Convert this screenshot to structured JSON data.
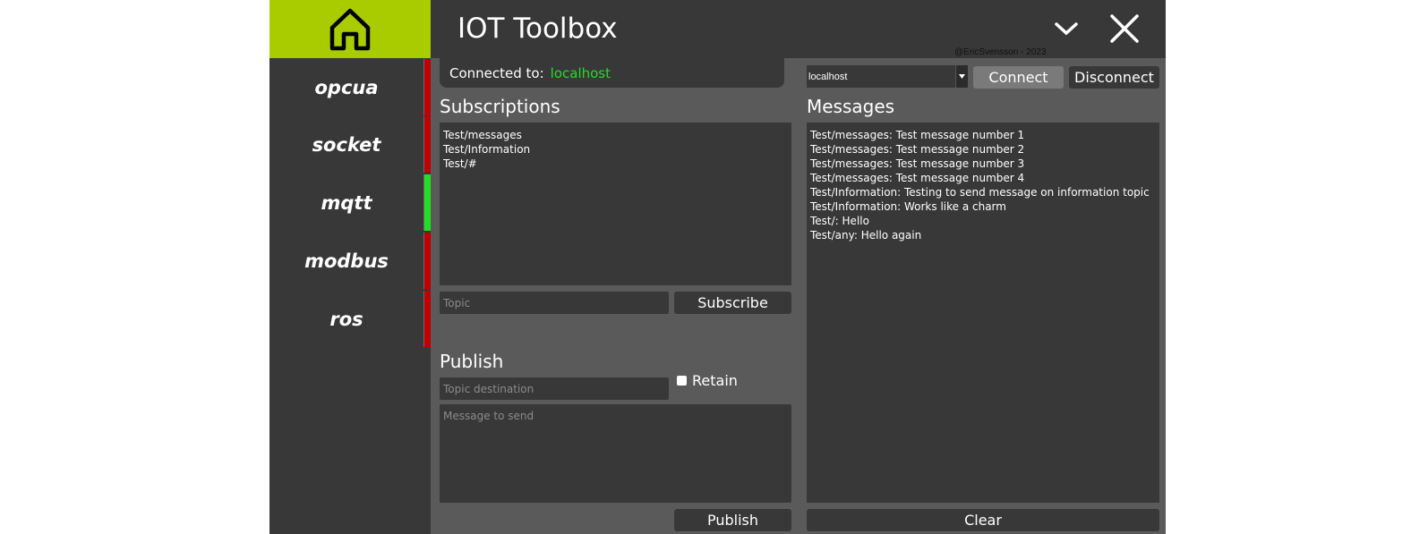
{
  "app": {
    "title": "IOT Toolbox",
    "copyright": "@EricSvensson - 2023"
  },
  "sidebar": {
    "items": [
      {
        "label": "opcua",
        "status_color": "#c00000"
      },
      {
        "label": "socket",
        "status_color": "#c00000"
      },
      {
        "label": "mqtt",
        "status_color": "#22dd22"
      },
      {
        "label": "modbus",
        "status_color": "#c00000"
      },
      {
        "label": "ros",
        "status_color": "#c00000"
      }
    ]
  },
  "connection": {
    "label": "Connected to:",
    "value": "localhost",
    "host_selected": "localhost",
    "connect_label": "Connect",
    "disconnect_label": "Disconnect"
  },
  "subscriptions": {
    "title": "Subscriptions",
    "items": [
      "Test/messages",
      "Test/Information",
      "Test/#"
    ],
    "topic_placeholder": "Topic",
    "subscribe_label": "Subscribe"
  },
  "publish": {
    "title": "Publish",
    "topic_placeholder": "Topic destination",
    "retain_label": "Retain",
    "message_placeholder": "Message to send",
    "publish_label": "Publish"
  },
  "messages": {
    "title": "Messages",
    "items": [
      "Test/messages: Test message number 1",
      "Test/messages: Test message number 2",
      "Test/messages: Test message number 3",
      "Test/messages: Test message number 4",
      "Test/Information: Testing to send message on information topic",
      "Test/Information: Works like a charm",
      "Test/: Hello",
      "Test/any: Hello again"
    ],
    "clear_label": "Clear"
  },
  "colors": {
    "accent": "#a8cc00",
    "connected": "#22dd22",
    "disconnected": "#c00000",
    "panel": "#383838",
    "background": "#5a5a5a"
  }
}
